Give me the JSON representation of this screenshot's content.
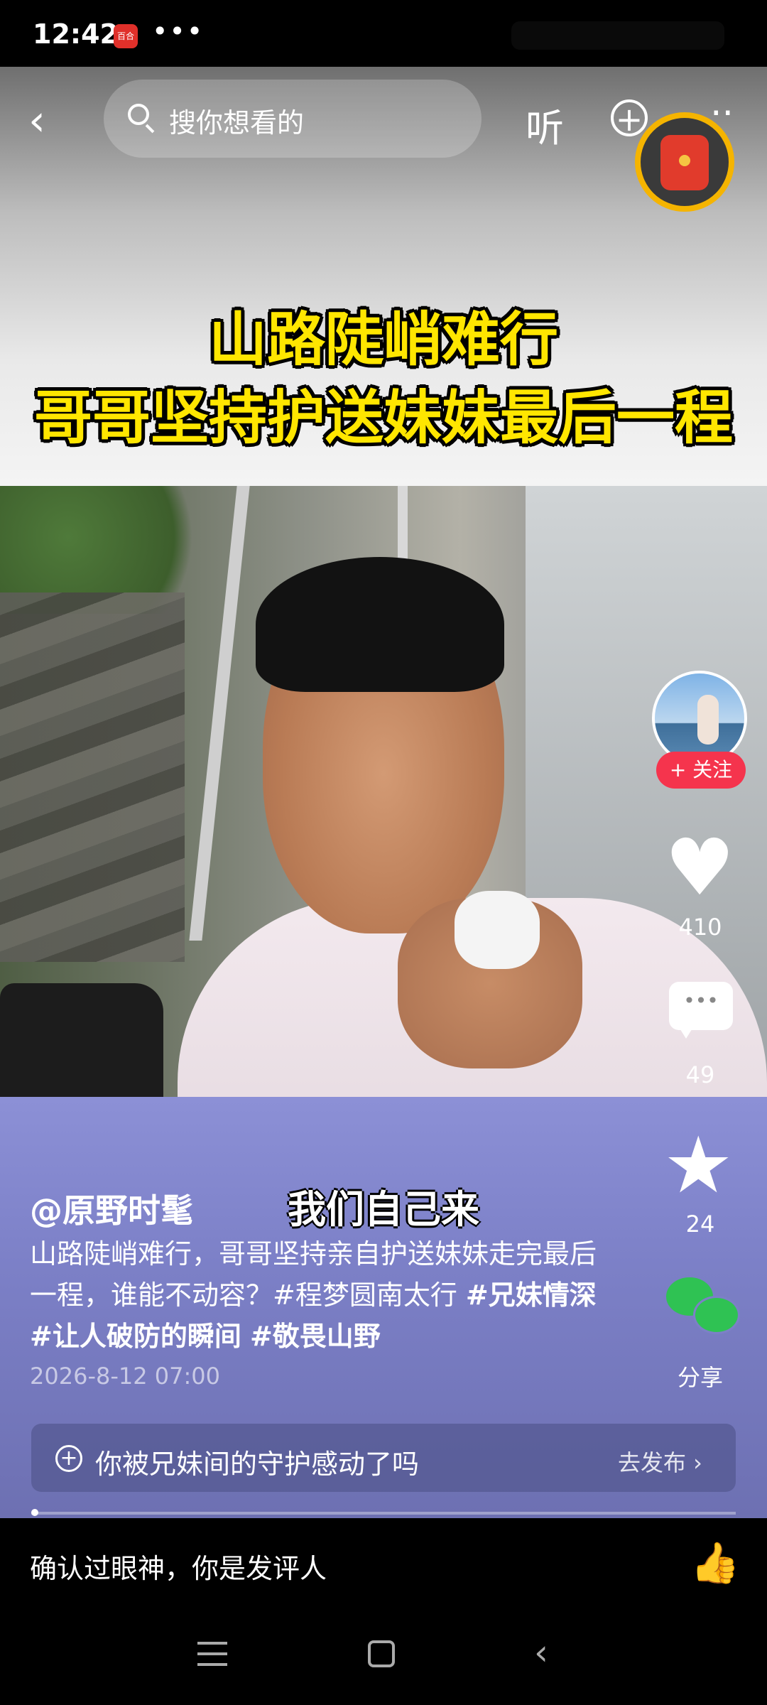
{
  "status_bar": {
    "time": "12:42",
    "app_badge": "百合",
    "dots": "•••"
  },
  "top_bar": {
    "back_icon": "chevron-left-icon",
    "search_placeholder": "搜你想看的",
    "listen_label": "听",
    "add_icon": "plus-circle-icon",
    "more_icon": "more-icon"
  },
  "video": {
    "headline_line1": "山路陡峭难行",
    "headline_line2": "哥哥坚持护送妹妹最后一程",
    "subtitle": "我们自己来"
  },
  "right_rail": {
    "follow_label": "+ 关注",
    "like_count": "410",
    "comment_count": "49",
    "favorite_count": "24",
    "share_label": "分享"
  },
  "post": {
    "author": "@原野时髦",
    "desc_plain": "山路陡峭难行，哥哥坚持亲自护送妹妹走完最后一程，谁能不动容？#程梦圆南太行 ",
    "tags": [
      "#兄妹情深",
      "#让人破防的瞬间",
      "#敬畏山野"
    ],
    "date": "2026-8-12 07:00"
  },
  "topic_bar": {
    "text": "你被兄妹间的守护感动了吗",
    "action": "去发布 ›"
  },
  "comment_bar": {
    "placeholder": "确认过眼神，你是发评人",
    "emojis": [
      "😂",
      "😆",
      "👍"
    ]
  },
  "nav": {
    "back_glyph": "‹"
  },
  "colors": {
    "accent_red": "#f5344d",
    "headline_yellow": "#ffe600",
    "wechat_green": "#2fc253",
    "panel_purple": "#7c80c7"
  }
}
